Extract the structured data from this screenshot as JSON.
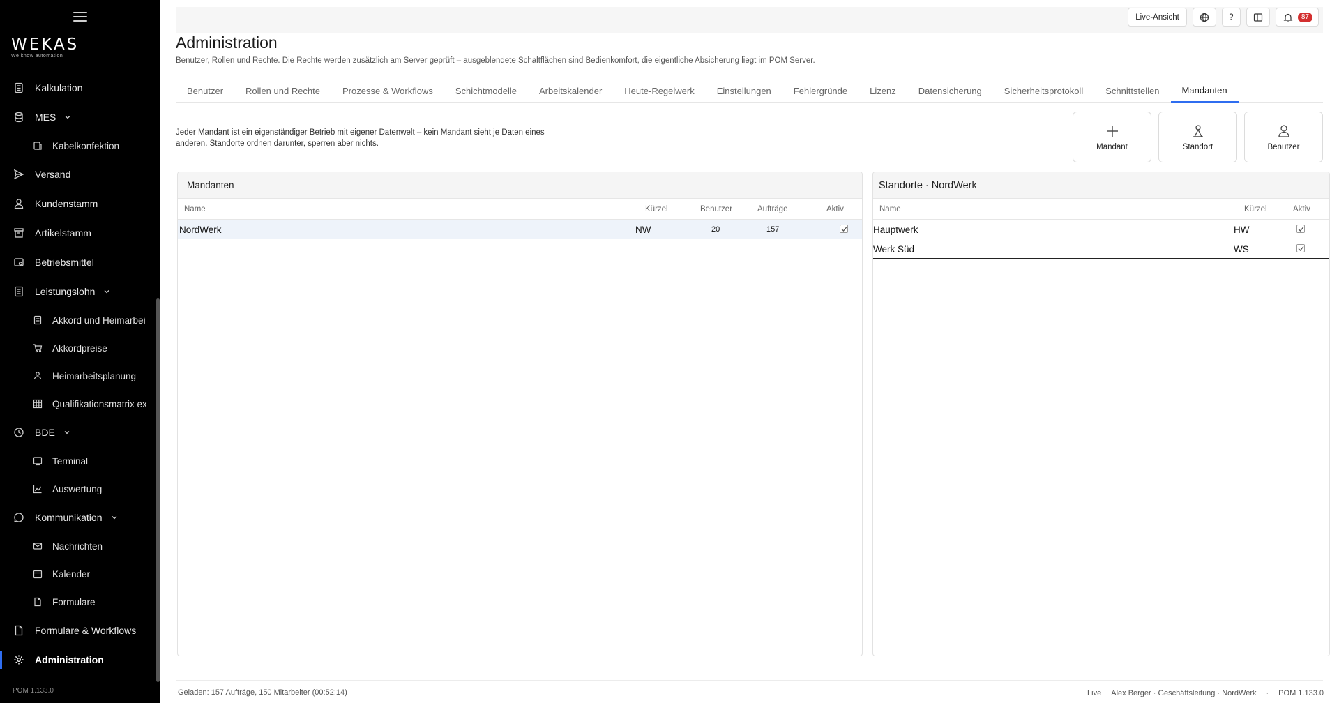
{
  "brand": {
    "logo": "WEKAS",
    "tagline": "We know automation",
    "version": "POM 1.133.0"
  },
  "nav": {
    "kalkulation": "Kalkulation",
    "mes": "MES",
    "kabelkonfektion": "Kabelkonfektion",
    "versand": "Versand",
    "kundenstamm": "Kundenstamm",
    "artikelstamm": "Artikelstamm",
    "betriebsmittel": "Betriebsmittel",
    "leistungslohn": "Leistungslohn",
    "akkord_heimarbeit": "Akkord und Heimarbei",
    "akkordpreise": "Akkordpreise",
    "heimarbeitsplanung": "Heimarbeitsplanung",
    "qualifikationsmatrix": "Qualifikationsmatrix ex",
    "bde": "BDE",
    "terminal": "Terminal",
    "auswertung": "Auswertung",
    "kommunikation": "Kommunikation",
    "nachrichten": "Nachrichten",
    "kalender": "Kalender",
    "formulare": "Formulare",
    "formulare_workflows": "Formulare & Workflows",
    "administration": "Administration"
  },
  "topbar": {
    "live_view": "Live-Ansicht",
    "help": "?",
    "notifications": "87"
  },
  "page": {
    "title": "Administration",
    "description": "Benutzer, Rollen und Rechte. Die Rechte werden zusätzlich am Server geprüft – ausgeblendete Schaltflächen sind Bedienkomfort, die eigentliche Absicherung liegt im POM Server."
  },
  "tabs": {
    "benutzer": "Benutzer",
    "rollen": "Rollen und Rechte",
    "prozesse": "Prozesse & Workflows",
    "schichtmodelle": "Schichtmodelle",
    "arbeitskalender": "Arbeitskalender",
    "regelwerk": "Heute-Regelwerk",
    "einstellungen": "Einstellungen",
    "fehlergruende": "Fehlergründe",
    "lizenz": "Lizenz",
    "datensicherung": "Datensicherung",
    "sicherheitsprotokoll": "Sicherheitsprotokoll",
    "schnittstellen": "Schnittstellen",
    "mandanten": "Mandanten"
  },
  "intro": {
    "line1": "Jeder Mandant ist ein eigenständiger Betrieb mit eigener Datenwelt – kein Mandant sieht je Daten eines",
    "line2": "anderen. Standorte ordnen darunter, sperren aber nichts."
  },
  "actions": {
    "mandant": "Mandant",
    "standort": "Standort",
    "benutzer": "Benutzer"
  },
  "mandanten_panel": {
    "title": "Mandanten",
    "columns": {
      "name": "Name",
      "kuerzel": "Kürzel",
      "benutzer": "Benutzer",
      "auftraege": "Aufträge",
      "aktiv": "Aktiv"
    },
    "rows": [
      {
        "name": "NordWerk",
        "kuerzel": "NW",
        "benutzer": "20",
        "auftraege": "157",
        "aktiv": true
      }
    ]
  },
  "standorte_panel": {
    "title": "Standorte · NordWerk",
    "columns": {
      "name": "Name",
      "kuerzel": "Kürzel",
      "aktiv": "Aktiv"
    },
    "rows": [
      {
        "name": "Hauptwerk",
        "kuerzel": "HW",
        "aktiv": true
      },
      {
        "name": "Werk Süd",
        "kuerzel": "WS",
        "aktiv": true
      }
    ]
  },
  "footer": {
    "loaded": "Geladen: 157 Aufträge, 150 Mitarbeiter (00:52:14)",
    "status": "Live",
    "user": "Alex Berger · Geschäftsleitung · NordWerk",
    "sep": "·",
    "version": "POM 1.133.0"
  },
  "colors": {
    "accent": "#2f6df0",
    "sidebar_bg": "#000000",
    "badge": "#d32f2f"
  }
}
